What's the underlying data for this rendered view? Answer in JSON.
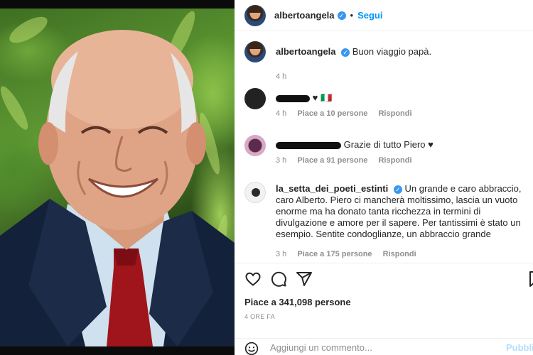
{
  "post_author": {
    "username": "albertoangela",
    "follow_label": "Segui",
    "separator": "•"
  },
  "caption": {
    "username": "albertoangela",
    "text": "Buon viaggio papà.",
    "time": "4 h"
  },
  "comments": [
    {
      "text": "♥ 🇮🇹",
      "time": "4 h",
      "likes": "Piace a 10 persone",
      "reply": "Rispondi",
      "avatar": "dark-avatar-icon"
    },
    {
      "text": "Grazie di tutto Piero ♥",
      "time": "3 h",
      "likes": "Piace a 91 persone",
      "reply": "Rispondi",
      "avatar": "pink-avatar-icon"
    },
    {
      "username": "la_setta_dei_poeti_estinti",
      "text": "Un grande e caro abbraccio, caro Alberto. Piero ci mancherà moltissimo, lascia un vuoto enorme ma ha donato tanta ricchezza in termini di divulgazione e amore per il sapere. Per tantissimi è stato un esempio. Sentite condoglianze, un abbraccio grande",
      "time": "3 h",
      "likes": "Piace a 175 persone",
      "reply": "Rispondi",
      "avatar": "bird-avatar-icon"
    }
  ],
  "actions": {
    "icons": [
      "heart-icon",
      "comment-icon",
      "share-icon",
      "bookmark-icon"
    ]
  },
  "likes_summary": "Piace a 341,098 persone",
  "post_time": "4 ORE FA",
  "add_comment": {
    "placeholder": "Aggiungi un commento...",
    "publish_label": "Pubblica"
  },
  "colors": {
    "accent": "#0095f6",
    "verified": "#3897f0",
    "muted": "#8e8e8e",
    "publish_disabled": "#b2dffc"
  }
}
